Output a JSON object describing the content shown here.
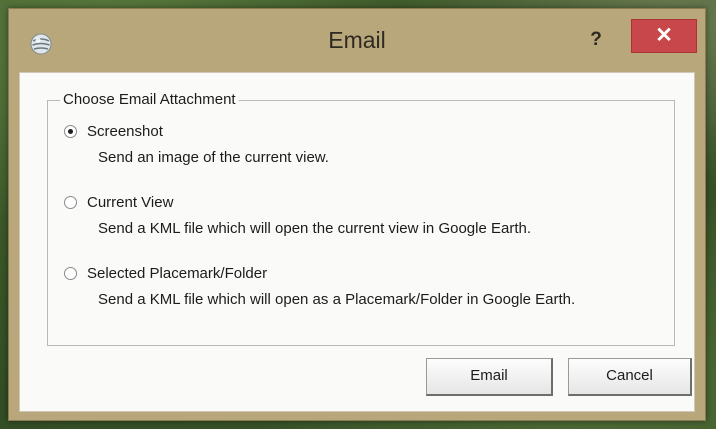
{
  "window": {
    "title": "Email",
    "help_symbol": "?",
    "close_symbol": "✕",
    "icon": "earth-globe-icon"
  },
  "group": {
    "legend": "Choose Email Attachment",
    "options": [
      {
        "label": "Screenshot",
        "description": "Send an image of the current view.",
        "selected": true
      },
      {
        "label": "Current View",
        "description": "Send a KML file which will open the current view in Google Earth.",
        "selected": false
      },
      {
        "label": "Selected Placemark/Folder",
        "description": "Send a KML file which will open as a Placemark/Folder in Google Earth.",
        "selected": false
      }
    ]
  },
  "buttons": {
    "email": "Email",
    "cancel": "Cancel"
  },
  "colors": {
    "frame": "#b9a77c",
    "close_button": "#c8474a",
    "client_background": "#fafaf8"
  }
}
